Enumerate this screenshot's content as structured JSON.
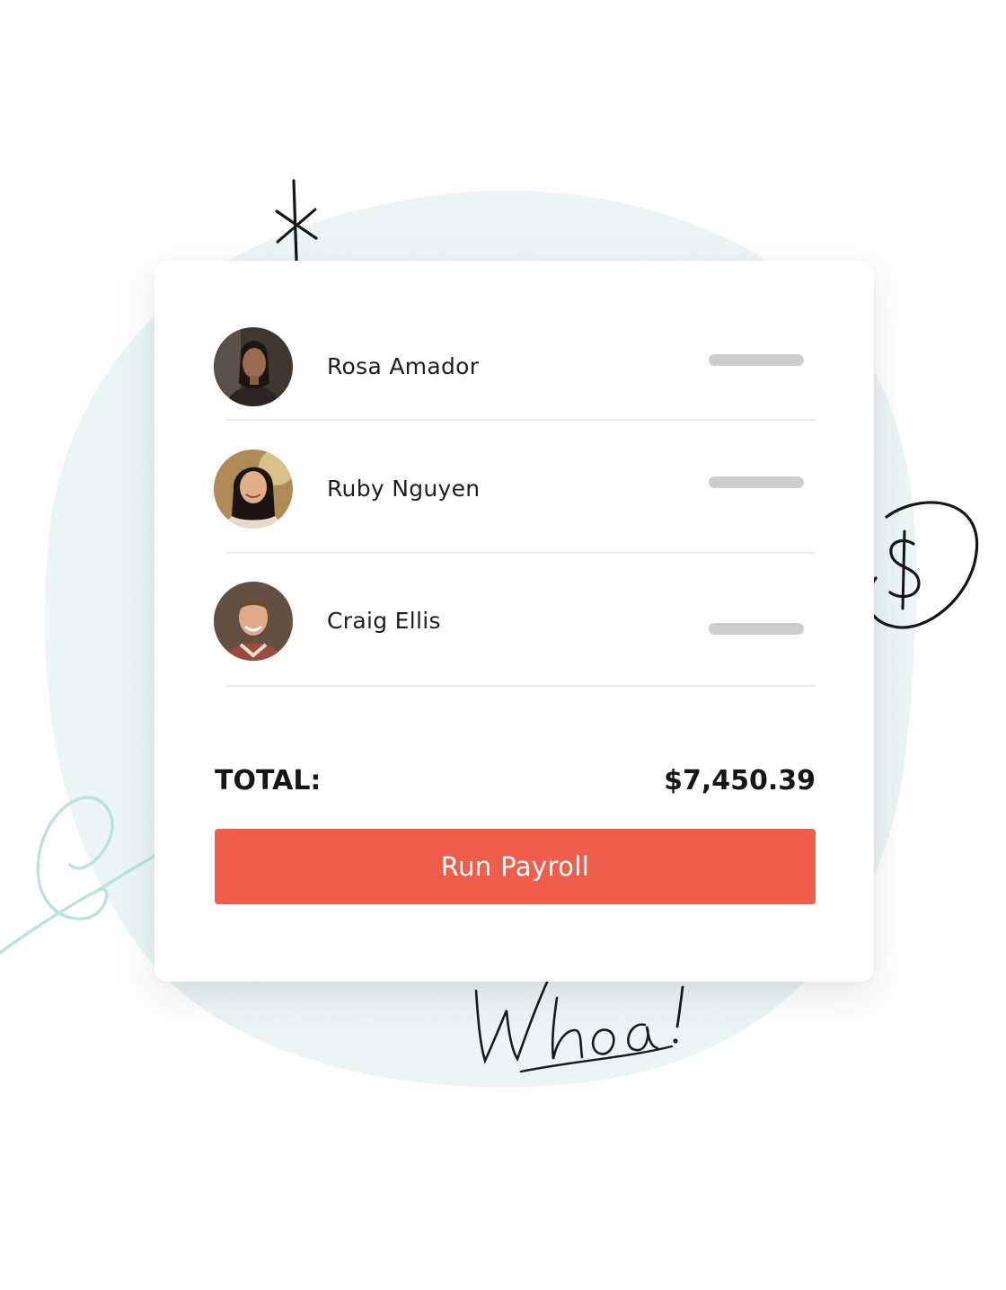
{
  "employees": [
    {
      "name": "Rosa Amador"
    },
    {
      "name": "Ruby Nguyen"
    },
    {
      "name": "Craig Ellis"
    }
  ],
  "total": {
    "label": "TOTAL:",
    "value": "$7,450.39"
  },
  "actions": {
    "run_payroll_label": "Run Payroll"
  },
  "decorations": {
    "handwritten_note": "Whoa!",
    "dollar_symbol": "$"
  },
  "colors": {
    "accent": "#f05d4b",
    "blob": "#e3f1f1",
    "placeholder_bar": "#cdcdcd"
  }
}
